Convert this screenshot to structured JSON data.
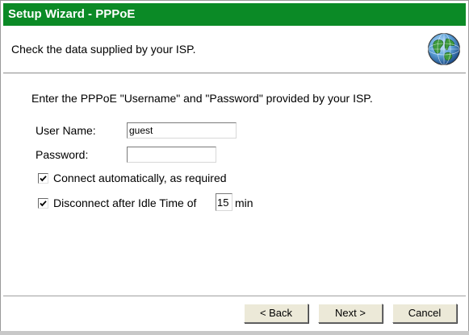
{
  "window": {
    "title": "Setup Wizard - PPPoE",
    "title_bar_color": "#0b8a26"
  },
  "header": {
    "text": "Check the data supplied by your ISP.",
    "icon": "globe-icon"
  },
  "content": {
    "instruction": "Enter the PPPoE \"Username\" and \"Password\" provided by your ISP.",
    "username_label": "User Name:",
    "username_value": "guest",
    "password_label": "Password:",
    "password_value": "",
    "connect_auto_label": "Connect automatically, as required",
    "connect_auto_checked": true,
    "disconnect_idle_label": "Disconnect after Idle Time of",
    "disconnect_idle_checked": true,
    "idle_time_value": "15",
    "idle_time_unit": "min"
  },
  "footer": {
    "back_label": "< Back",
    "next_label": "Next >",
    "cancel_label": "Cancel"
  }
}
